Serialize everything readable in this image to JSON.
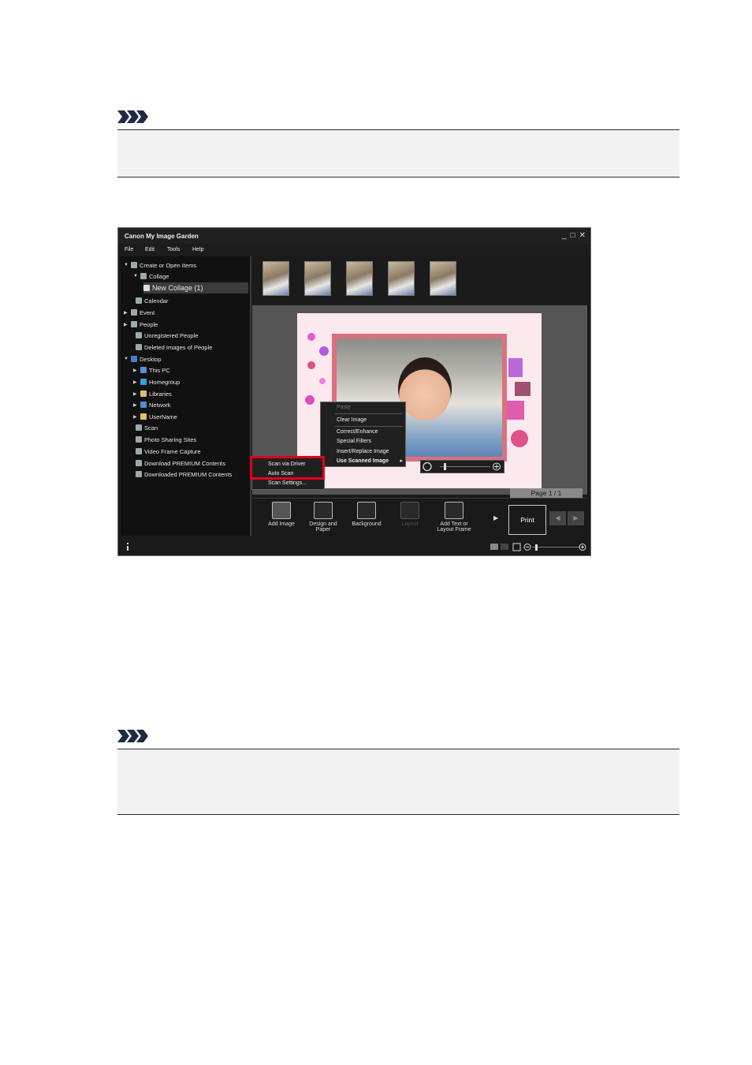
{
  "app": {
    "title": "Canon My Image Garden",
    "window_buttons": [
      "_",
      "□",
      "✕"
    ],
    "menu": [
      "File",
      "Edit",
      "Tools",
      "Help"
    ]
  },
  "sidebar": {
    "items": [
      {
        "label": "Create or Open Items",
        "icon": "create-items-icon"
      },
      {
        "label": "Collage",
        "icon": "collage-icon"
      },
      {
        "label": "New Collage (1)",
        "icon": "new-collage-icon",
        "selected": true
      },
      {
        "label": "Calendar",
        "icon": "calendar-icon"
      },
      {
        "label": "Event",
        "icon": "event-icon"
      },
      {
        "label": "People",
        "icon": "people-icon"
      },
      {
        "label": "Unregistered People",
        "icon": "unregistered-people-icon"
      },
      {
        "label": "Deleted Images of People",
        "icon": "deleted-people-icon"
      },
      {
        "label": "Desktop",
        "icon": "desktop-icon"
      },
      {
        "label": "This PC",
        "icon": "this-pc-icon"
      },
      {
        "label": "Homegroup",
        "icon": "homegroup-icon"
      },
      {
        "label": "Libraries",
        "icon": "libraries-icon"
      },
      {
        "label": "Network",
        "icon": "network-icon"
      },
      {
        "label": "UserName",
        "icon": "user-folder-icon"
      },
      {
        "label": "Scan",
        "icon": "scan-icon"
      },
      {
        "label": "Photo Sharing Sites",
        "icon": "photo-sharing-icon"
      },
      {
        "label": "Video Frame Capture",
        "icon": "video-frame-icon"
      },
      {
        "label": "Download PREMIUM Contents",
        "icon": "download-premium-icon"
      },
      {
        "label": "Downloaded PREMIUM Contents",
        "icon": "downloaded-premium-icon"
      }
    ]
  },
  "context_menu": {
    "items": [
      "Paste",
      "Clear Image",
      "Correct/Enhance",
      "Special Filters",
      "Insert/Replace Image",
      "Use Scanned Image"
    ],
    "submenu_arrow": "▸"
  },
  "scan_submenu": {
    "items": [
      "Scan via Driver",
      "Auto Scan",
      "Scan Settings..."
    ]
  },
  "page_indicator": "Page 1 / 1",
  "toolbar": {
    "buttons": [
      "Add Image",
      "Design and Paper",
      "Background",
      "Layout",
      "Add Text or Layout Frame"
    ],
    "print_label": "Print",
    "next_arrow": "▶",
    "nav": [
      "◀",
      "▶"
    ]
  },
  "colors": {
    "highlight": "#e1001d",
    "window_bg": "#1a1a1a",
    "note_rule": "#1f2a44"
  }
}
